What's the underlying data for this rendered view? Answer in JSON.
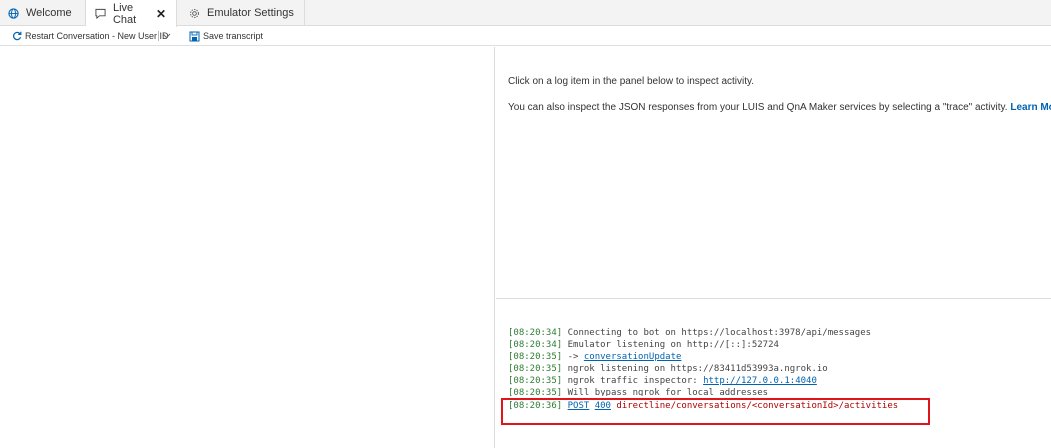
{
  "tabs": [
    {
      "label": "Welcome",
      "icon": "globe-icon"
    },
    {
      "label": "Live Chat",
      "icon": "chat-icon",
      "active": true,
      "close": "✕"
    },
    {
      "label": "Emulator Settings",
      "icon": "gear-icon"
    }
  ],
  "toolbar": {
    "restart_label": "Restart Conversation - New User ID",
    "save_label": "Save transcript"
  },
  "inspector": {
    "line1": "Click on a log item in the panel below to inspect activity.",
    "line2": "You can also inspect the JSON responses from your LUIS and QnA Maker services by selecting a \"trace\" activity.",
    "learn_more": "Learn More."
  },
  "log": [
    {
      "time": "[08:20:34]",
      "text": "Connecting to bot on https://localhost:3978/api/messages"
    },
    {
      "time": "[08:20:34]",
      "text": "Emulator listening on http://[::]:52724"
    },
    {
      "time": "[08:20:35]",
      "prefix": "->",
      "link": "conversationUpdate"
    },
    {
      "time": "[08:20:35]",
      "text": "ngrok listening on https://83411d53993a.ngrok.io"
    },
    {
      "time": "[08:20:35]",
      "text": "ngrok traffic inspector:",
      "link": "http://127.0.0.1:4040"
    },
    {
      "time": "[08:20:35]",
      "text": "Will bypass ngrok for local addresses"
    },
    {
      "time": "[08:20:36]",
      "method": "POST",
      "status": "400",
      "path": "directline/conversations/<conversationId>/activities"
    }
  ],
  "colors": {
    "highlight": "#e0151b",
    "link": "#0063b1",
    "timestamp": "#2e7d32",
    "error": "#b00000"
  }
}
